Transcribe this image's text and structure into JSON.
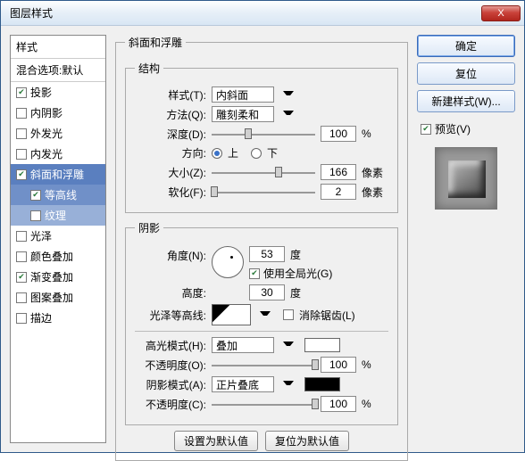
{
  "window": {
    "title": "图层样式"
  },
  "left": {
    "header": "样式",
    "blend": "混合选项:默认",
    "items": [
      {
        "label": "投影",
        "checked": true
      },
      {
        "label": "内阴影",
        "checked": false
      },
      {
        "label": "外发光",
        "checked": false
      },
      {
        "label": "内发光",
        "checked": false
      },
      {
        "label": "斜面和浮雕",
        "checked": true,
        "selected": 0
      },
      {
        "label": "等高线",
        "checked": true,
        "indent": true,
        "selected": 1
      },
      {
        "label": "纹理",
        "checked": false,
        "indent": true,
        "selected": 2
      },
      {
        "label": "光泽",
        "checked": false
      },
      {
        "label": "颜色叠加",
        "checked": false
      },
      {
        "label": "渐变叠加",
        "checked": true
      },
      {
        "label": "图案叠加",
        "checked": false
      },
      {
        "label": "描边",
        "checked": false
      }
    ]
  },
  "center": {
    "title": "斜面和浮雕",
    "struct": {
      "legend": "结构",
      "style_lbl": "样式(T):",
      "style_val": "内斜面",
      "tech_lbl": "方法(Q):",
      "tech_val": "雕刻柔和",
      "depth_lbl": "深度(D):",
      "depth_val": "100",
      "depth_unit": "%",
      "dir_lbl": "方向:",
      "dir_up": "上",
      "dir_down": "下",
      "size_lbl": "大小(Z):",
      "size_val": "166",
      "size_unit": "像素",
      "soften_lbl": "软化(F):",
      "soften_val": "2",
      "soften_unit": "像素"
    },
    "shadow": {
      "legend": "阴影",
      "angle_lbl": "角度(N):",
      "angle_val": "53",
      "angle_unit": "度",
      "global_label": "使用全局光(G)",
      "alt_lbl": "高度:",
      "alt_val": "30",
      "alt_unit": "度",
      "gloss_lbl": "光泽等高线:",
      "aa_label": "消除锯齿(L)",
      "hi_mode_lbl": "高光模式(H):",
      "hi_mode_val": "叠加",
      "hi_op_lbl": "不透明度(O):",
      "hi_op_val": "100",
      "pct": "%",
      "sh_mode_lbl": "阴影模式(A):",
      "sh_mode_val": "正片叠底",
      "sh_op_lbl": "不透明度(C):",
      "sh_op_val": "100"
    },
    "defaults": {
      "set": "设置为默认值",
      "reset": "复位为默认值"
    }
  },
  "right": {
    "ok": "确定",
    "cancel": "复位",
    "newstyle": "新建样式(W)...",
    "preview_label": "预览(V)"
  }
}
